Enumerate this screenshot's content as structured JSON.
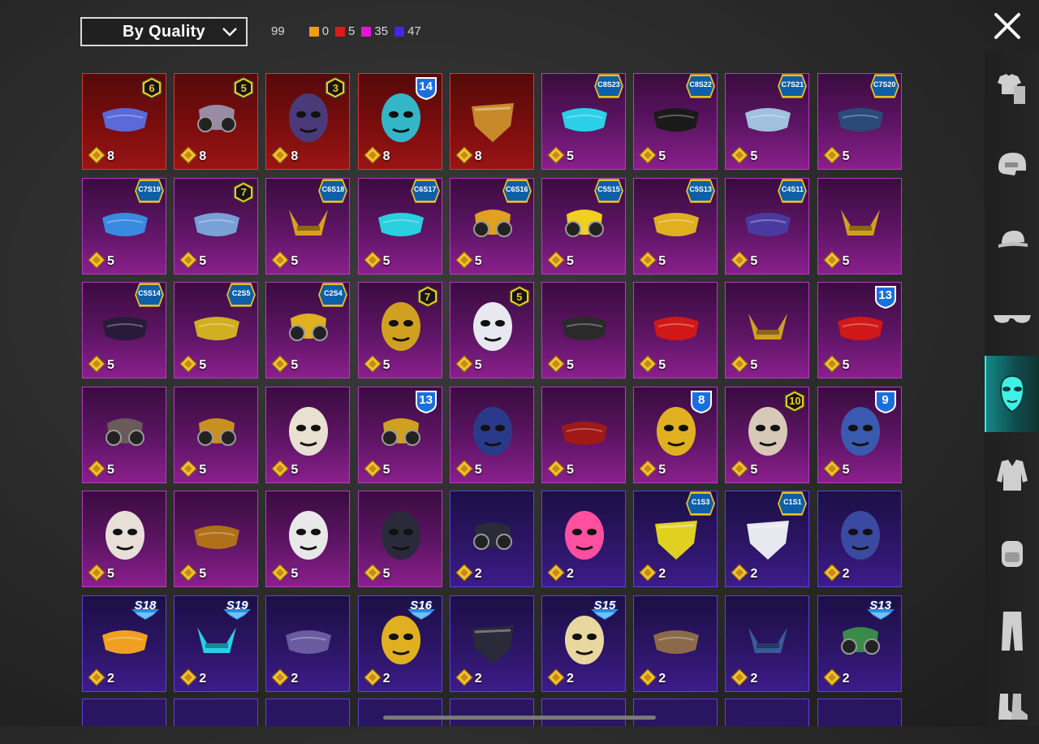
{
  "sort": {
    "label": "By Quality",
    "icon": "chevron-down-icon"
  },
  "counts": {
    "total": "99",
    "orange": {
      "value": "0",
      "color": "#f39c12"
    },
    "red": {
      "value": "5",
      "color": "#e01818"
    },
    "pink": {
      "value": "35",
      "color": "#e514d6"
    },
    "blue": {
      "value": "47",
      "color": "#4d22e6"
    }
  },
  "colors": {
    "accent_active": "#1ac4bf"
  },
  "sidebar": [
    {
      "icon": "outfit-icon"
    },
    {
      "icon": "helmet-icon"
    },
    {
      "icon": "cap-icon"
    },
    {
      "icon": "glasses-icon"
    },
    {
      "icon": "mask-icon",
      "active": true
    },
    {
      "icon": "jacket-icon"
    },
    {
      "icon": "backpack-icon"
    },
    {
      "icon": "pants-icon"
    },
    {
      "icon": "boots-icon"
    }
  ],
  "items": [
    {
      "q": "red",
      "price": "8",
      "badge": "6",
      "bt": "hex",
      "art": "bird-mask",
      "color": "#5a6ad8"
    },
    {
      "q": "red",
      "price": "8",
      "badge": "5",
      "bt": "hex",
      "art": "gas-mask",
      "color": "#9a8aa6"
    },
    {
      "q": "red",
      "price": "8",
      "badge": "3",
      "bt": "hex",
      "art": "wolf-mask",
      "color": "#4a3a7a"
    },
    {
      "q": "red",
      "price": "8",
      "badge": "14",
      "bt": "shield",
      "art": "cyber-helmet",
      "color": "#33b6c8"
    },
    {
      "q": "red",
      "price": "8",
      "badge": "",
      "bt": "",
      "art": "leopard-mask",
      "color": "#c8892a"
    },
    {
      "q": "pink",
      "price": "5",
      "badge": "C8S23",
      "bt": "tag",
      "art": "neon-mask",
      "color": "#2bd0e8"
    },
    {
      "q": "pink",
      "price": "5",
      "badge": "C8S22",
      "bt": "tag",
      "art": "black-mask",
      "color": "#1a1a1a"
    },
    {
      "q": "pink",
      "price": "5",
      "badge": "C7S21",
      "bt": "tag",
      "art": "robot-mask",
      "color": "#9fc0de"
    },
    {
      "q": "pink",
      "price": "5",
      "badge": "C7S20",
      "bt": "tag",
      "art": "slim-mask",
      "color": "#2a4a7a"
    },
    {
      "q": "pink",
      "price": "5",
      "badge": "C7S19",
      "bt": "tag",
      "art": "pixel-mask",
      "color": "#3a8ae0"
    },
    {
      "q": "pink",
      "price": "5",
      "badge": "7",
      "bt": "hex",
      "art": "tiny-mask",
      "color": "#7aa0d8"
    },
    {
      "q": "pink",
      "price": "5",
      "badge": "C6S18",
      "bt": "tag",
      "art": "gold-horns",
      "color": "#d9a020"
    },
    {
      "q": "pink",
      "price": "5",
      "badge": "C6S17",
      "bt": "tag",
      "art": "teal-mask",
      "color": "#2ad0e0"
    },
    {
      "q": "pink",
      "price": "5",
      "badge": "C6S16",
      "bt": "tag",
      "art": "color-gas",
      "color": "#e0a020"
    },
    {
      "q": "pink",
      "price": "5",
      "badge": "C5S15",
      "bt": "tag",
      "art": "yellow-gas",
      "color": "#f0d020"
    },
    {
      "q": "pink",
      "price": "5",
      "badge": "C5S13",
      "bt": "tag",
      "art": "graffiti-mask",
      "color": "#e0b020"
    },
    {
      "q": "pink",
      "price": "5",
      "badge": "C4S11",
      "bt": "tag",
      "art": "dark-mask",
      "color": "#4a3aa0"
    },
    {
      "q": "pink",
      "price": "5",
      "badge": "",
      "bt": "",
      "art": "gold-visor",
      "color": "#d0a020"
    },
    {
      "q": "pink",
      "price": "5",
      "badge": "C5S14",
      "bt": "tag",
      "art": "face-mask",
      "color": "#2a1a3a"
    },
    {
      "q": "pink",
      "price": "5",
      "badge": "C2S5",
      "bt": "tag",
      "art": "chain-mask",
      "color": "#d0b020"
    },
    {
      "q": "pink",
      "price": "5",
      "badge": "C2S4",
      "bt": "tag",
      "art": "gold-gas",
      "color": "#e0b020"
    },
    {
      "q": "pink",
      "price": "5",
      "badge": "7",
      "bt": "hex",
      "art": "gold-helm",
      "color": "#d0a020"
    },
    {
      "q": "pink",
      "price": "5",
      "badge": "5",
      "bt": "hex",
      "art": "clown-mask",
      "color": "#e8e8f0"
    },
    {
      "q": "pink",
      "price": "5",
      "badge": "",
      "bt": "",
      "art": "face-mask",
      "color": "#2a2a2a"
    },
    {
      "q": "pink",
      "price": "5",
      "badge": "",
      "bt": "",
      "art": "red-mask",
      "color": "#d01818"
    },
    {
      "q": "pink",
      "price": "5",
      "badge": "",
      "bt": "",
      "art": "gold-beard",
      "color": "#d0a020"
    },
    {
      "q": "pink",
      "price": "5",
      "badge": "13",
      "bt": "shield",
      "art": "red-white",
      "color": "#d01818"
    },
    {
      "q": "pink",
      "price": "5",
      "badge": "",
      "bt": "",
      "art": "horn-gas",
      "color": "#6a5a5a"
    },
    {
      "q": "pink",
      "price": "5",
      "badge": "",
      "bt": "",
      "art": "gold-gas",
      "color": "#c89020"
    },
    {
      "q": "pink",
      "price": "5",
      "badge": "",
      "bt": "",
      "art": "oni-mask",
      "color": "#e8e0d0"
    },
    {
      "q": "pink",
      "price": "5",
      "badge": "13",
      "bt": "shield",
      "art": "gold-gas",
      "color": "#d0a020"
    },
    {
      "q": "pink",
      "price": "5",
      "badge": "",
      "bt": "",
      "art": "cat-mask",
      "color": "#2a3a8a"
    },
    {
      "q": "pink",
      "price": "5",
      "badge": "",
      "bt": "",
      "art": "red-mask",
      "color": "#a01818"
    },
    {
      "q": "pink",
      "price": "5",
      "badge": "8",
      "bt": "shield",
      "art": "yellow-helm",
      "color": "#e0b020"
    },
    {
      "q": "pink",
      "price": "5",
      "badge": "10",
      "bt": "hex",
      "art": "skull-mask",
      "color": "#d8c8b8"
    },
    {
      "q": "pink",
      "price": "5",
      "badge": "9",
      "bt": "shield",
      "art": "blue-helm",
      "color": "#3a5ab0"
    },
    {
      "q": "pink",
      "price": "5",
      "badge": "",
      "bt": "",
      "art": "skull-horns",
      "color": "#e8e0d8"
    },
    {
      "q": "pink",
      "price": "5",
      "badge": "",
      "bt": "",
      "art": "plague-mask",
      "color": "#b0701a"
    },
    {
      "q": "pink",
      "price": "5",
      "badge": "",
      "bt": "",
      "art": "white-hood",
      "color": "#e8e8e8"
    },
    {
      "q": "pink",
      "price": "5",
      "badge": "",
      "bt": "",
      "art": "skull-scarf",
      "color": "#2a2a3a"
    },
    {
      "q": "blue",
      "price": "2",
      "badge": "",
      "bt": "",
      "art": "goggle-mask",
      "color": "#2a2a3a"
    },
    {
      "q": "blue",
      "price": "2",
      "badge": "",
      "bt": "",
      "art": "pink-mask",
      "color": "#ff4fa0"
    },
    {
      "q": "blue",
      "price": "2",
      "badge": "C1S3",
      "bt": "tag",
      "art": "yellow-bandana",
      "color": "#e0d020"
    },
    {
      "q": "blue",
      "price": "2",
      "badge": "C1S1",
      "bt": "tag",
      "art": "white-bandana",
      "color": "#e8e8f0"
    },
    {
      "q": "blue",
      "price": "2",
      "badge": "",
      "bt": "",
      "art": "blue-face",
      "color": "#3a4aa0"
    },
    {
      "q": "blue",
      "price": "2",
      "badge": "S18",
      "bt": "arrow",
      "art": "neon-mask",
      "color": "#f0a020"
    },
    {
      "q": "blue",
      "price": "2",
      "badge": "S19",
      "bt": "arrow",
      "art": "cyan-visor",
      "color": "#2ad0e8"
    },
    {
      "q": "blue",
      "price": "2",
      "badge": "",
      "bt": "",
      "art": "purple-mask",
      "color": "#6a5aa0"
    },
    {
      "q": "blue",
      "price": "2",
      "badge": "S16",
      "bt": "arrow",
      "art": "yellow-helm",
      "color": "#e0b020"
    },
    {
      "q": "blue",
      "price": "2",
      "badge": "",
      "bt": "",
      "art": "scarf",
      "color": "#2a2a3a"
    },
    {
      "q": "blue",
      "price": "2",
      "badge": "S15",
      "bt": "arrow",
      "art": "skull-helm",
      "color": "#e8d8a0"
    },
    {
      "q": "blue",
      "price": "2",
      "badge": "",
      "bt": "",
      "art": "brown-mask",
      "color": "#8a6a4a"
    },
    {
      "q": "blue",
      "price": "2",
      "badge": "",
      "bt": "",
      "art": "blue-visor",
      "color": "#3a5a9a"
    },
    {
      "q": "blue",
      "price": "2",
      "badge": "S13",
      "bt": "arrow",
      "art": "green-goggles",
      "color": "#3a8a4a"
    }
  ]
}
